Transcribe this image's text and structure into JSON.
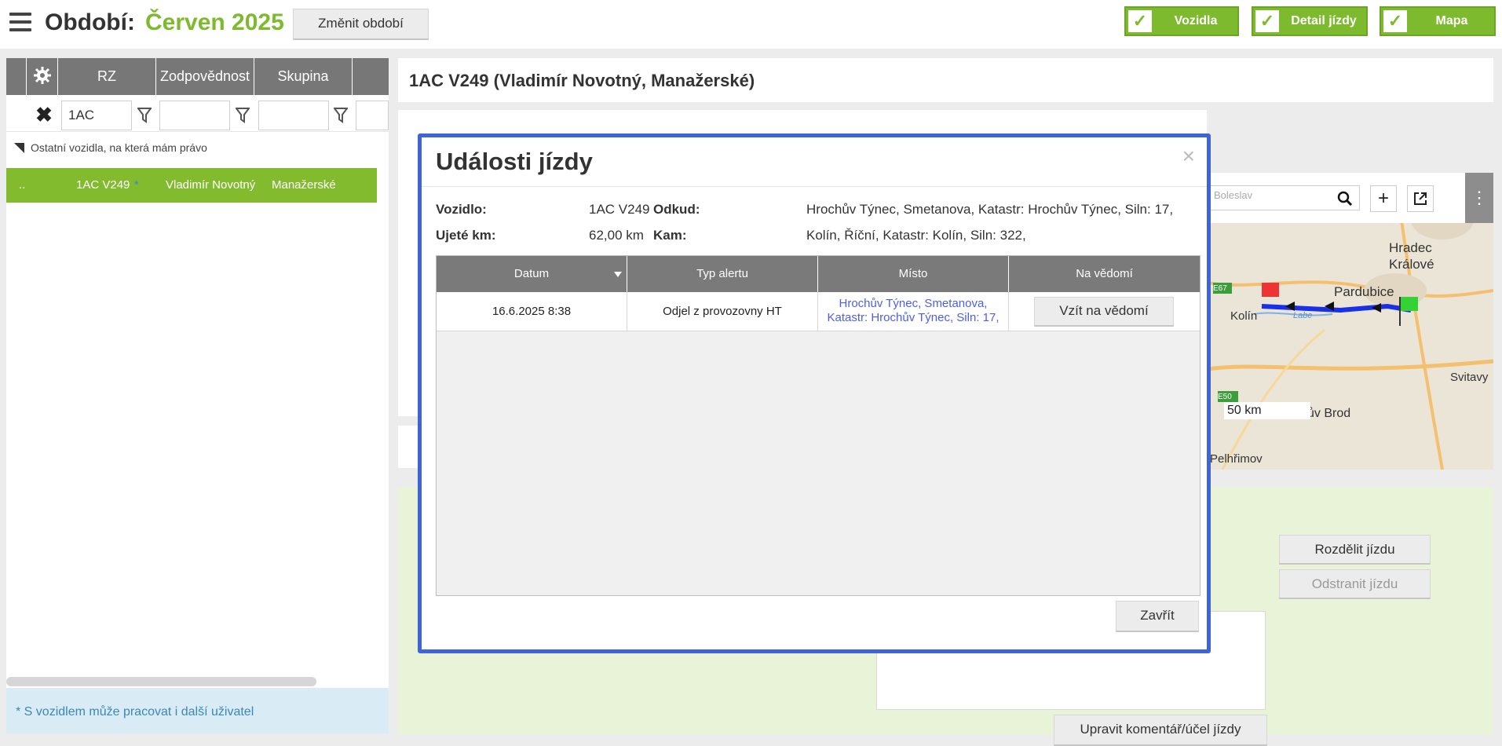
{
  "topbar": {
    "period_label": "Období:",
    "period_value": "Červen 2025",
    "change_period": "Změnit období",
    "toggles": [
      "Vozidla",
      "Detail jízdy",
      "Mapa"
    ],
    "toggle_color": "#7dba2e"
  },
  "vehicles": {
    "columns": [
      "RZ",
      "Zodpovědnost",
      "Skupina"
    ],
    "filter_rz": "1AC",
    "group_label": "Ostatní vozidla, na která mám právo",
    "row": {
      "dots": "..",
      "rz": "1AC V249",
      "star": "*",
      "driver": "Vladimír Novotný",
      "group": "Manažerské"
    },
    "info": "* S vozidlem může pracovat i další uživatel"
  },
  "detail": {
    "title": "1AC V249 (Vladimír Novotný, Manažerské)",
    "split_button": "Rozdělit jízdu",
    "remove_button": "Odstranit jízdu",
    "update_comment_button": "Upravit komentář/účel jízdy"
  },
  "map": {
    "labels": [
      "Hradec",
      "Králové",
      "Pardubice",
      "Kolín",
      "Svitavy",
      "Pelhřimov",
      "ův Brod",
      "Boleslav",
      "E67",
      "E50",
      "Labe"
    ],
    "scale": "50 km",
    "route_color": "#1a2fe8"
  },
  "modal": {
    "title": "Události jízdy",
    "close_glyph": "×",
    "vehicle_label": "Vozidlo:",
    "vehicle_value": "1AC V249",
    "km_label": "Ujeté km:",
    "km_value": "62,00 km",
    "from_label": "Odkud:",
    "from_value": "Hrochův Týnec, Smetanova, Katastr: Hrochův Týnec, Siln: 17,",
    "to_label": "Kam:",
    "to_value": "Kolín, Říční, Katastr: Kolín, Siln: 322,",
    "columns": [
      "Datum",
      "Typ alertu",
      "Místo",
      "Na vědomí"
    ],
    "row": {
      "date": "16.6.2025 8:38",
      "type": "Odjel z provozovny HT",
      "place_line1": "Hrochův Týnec, Smetanova,",
      "place_line2": "Katastr: Hrochův Týnec, Siln: 17,",
      "ack_button": "Vzít na vědomí"
    },
    "close_button": "Zavřít",
    "border_color": "#3e64d8"
  }
}
